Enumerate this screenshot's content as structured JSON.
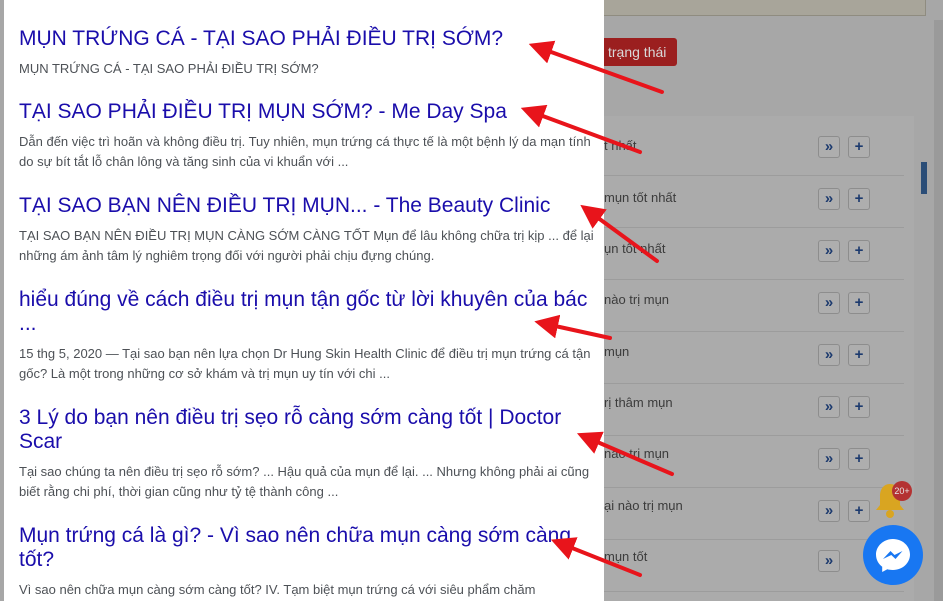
{
  "background": {
    "status_button": "trạng thái",
    "rows": [
      {
        "label": "t nhất"
      },
      {
        "label": "mụn tốt nhất"
      },
      {
        "label": "ụn tốt nhất"
      },
      {
        "label": "nào trị mụn"
      },
      {
        "label": "mụn"
      },
      {
        "label": "rị thâm mụn"
      },
      {
        "label": "nào trị mụn"
      },
      {
        "label": "ại nào trị mụn"
      },
      {
        "label": "mụn tốt"
      }
    ],
    "btn_next": "»",
    "btn_add": "+",
    "notification_count": "20+"
  },
  "results": [
    {
      "title": "MỤN TRỨNG CÁ - TẠI SAO PHẢI ĐIỀU TRỊ SỚM?",
      "snippet": "MỤN TRỨNG CÁ - TẠI SAO PHẢI ĐIỀU TRỊ SỚM?"
    },
    {
      "title": "TẠI SAO PHẢI ĐIỀU TRỊ MỤN SỚM? - Me Day Spa",
      "snippet": "Dẫn đến việc trì hoãn và không điều trị. Tuy nhiên, mụn trứng cá thực tế là một bệnh lý da mạn tính do sự bít tắt lỗ chân lông và tăng sinh của vi khuẩn với ..."
    },
    {
      "title": "TẠI SAO BẠN NÊN ĐIỀU TRỊ MỤN... - The Beauty Clinic",
      "snippet": "TẠI SAO BẠN NÊN ĐIỀU TRỊ MỤN CÀNG SỚM CÀNG TỐT Mụn để lâu không chữa trị kịp ... để lại những ám ảnh tâm lý nghiêm trọng đối với người phải chịu đựng chúng."
    },
    {
      "title": "hiểu đúng về cách điều trị mụn tận gốc từ lời khuyên của bác ...",
      "snippet": "15 thg 5, 2020 — Tại sao bạn nên lựa chọn Dr Hung Skin Health Clinic để điều trị mụn trứng cá tận gốc? Là một trong những cơ sở khám và trị mụn uy tín với chi ..."
    },
    {
      "title": "3 Lý do bạn nên điều trị sẹo rỗ càng sớm càng tốt | Doctor Scar",
      "snippet": "Tại sao chúng ta nên điều trị sẹo rỗ sớm? ... Hậu quả của mụn để lại. ... Nhưng không phải ai cũng biết rằng chi phí, thời gian cũng như tỷ tệ thành công ..."
    },
    {
      "title": "Mụn trứng cá là gì? - Vì sao nên chữa mụn càng sớm càng tốt?",
      "snippet": "Vì sao nên chữa mụn càng sớm càng tốt? IV. Tạm biệt mụn trứng cá với siêu phẩm chăm"
    }
  ],
  "colors": {
    "link": "#1a0dab",
    "snippet": "#4d5156",
    "arrow": "#e8141b",
    "messenger": "#1877f2"
  }
}
